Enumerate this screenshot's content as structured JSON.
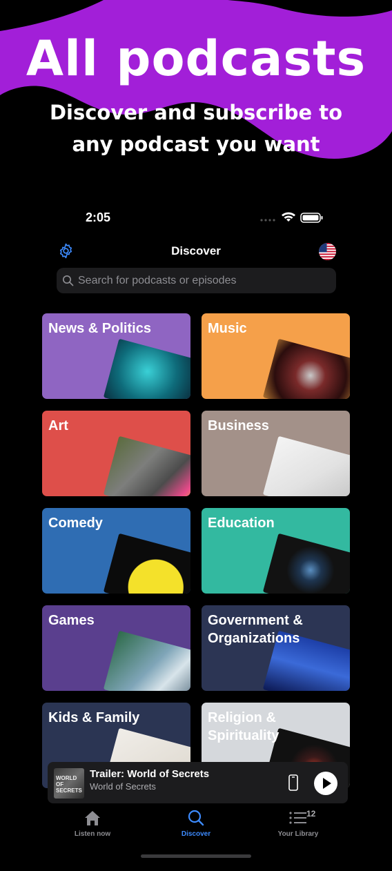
{
  "promo": {
    "title": "All podcasts",
    "subtitle": "Discover and subscribe to any podcast you want",
    "blob_color": "#a21fd8"
  },
  "status_bar": {
    "time": "2:05",
    "icons": [
      "signal-icon",
      "wifi-icon",
      "battery-icon"
    ]
  },
  "nav": {
    "title": "Discover",
    "left_icon": "gear-icon",
    "right_icon": "us-flag-icon"
  },
  "search": {
    "placeholder": "Search for podcasts or episodes",
    "value": ""
  },
  "categories": [
    {
      "label": "News & Politics",
      "color": "#8f65c2"
    },
    {
      "label": "Music",
      "color": "#f5a04a"
    },
    {
      "label": "Art",
      "color": "#de4f4a"
    },
    {
      "label": "Business",
      "color": "#a39189"
    },
    {
      "label": "Comedy",
      "color": "#2f6db3"
    },
    {
      "label": "Education",
      "color": "#33b9a0"
    },
    {
      "label": "Games",
      "color": "#5a3f8e"
    },
    {
      "label": "Government &\nOrganizations",
      "color": "#2c3554"
    },
    {
      "label": "Kids & Family",
      "color": "#2b3553"
    },
    {
      "label": "Religion &\nSpirituality",
      "color": "#d5d8dc"
    }
  ],
  "mini_player": {
    "title": "Trailer: World of Secrets",
    "subtitle": "World of Secrets",
    "artwork_text": "WORLD OF SECRETS"
  },
  "tabs": [
    {
      "label": "Listen now",
      "icon": "house-icon"
    },
    {
      "label": "Discover",
      "icon": "magnifier-icon",
      "active": true
    },
    {
      "label": "Your Library",
      "icon": "list-icon",
      "badge": "12"
    }
  ],
  "accent_color": "#3d8bff"
}
